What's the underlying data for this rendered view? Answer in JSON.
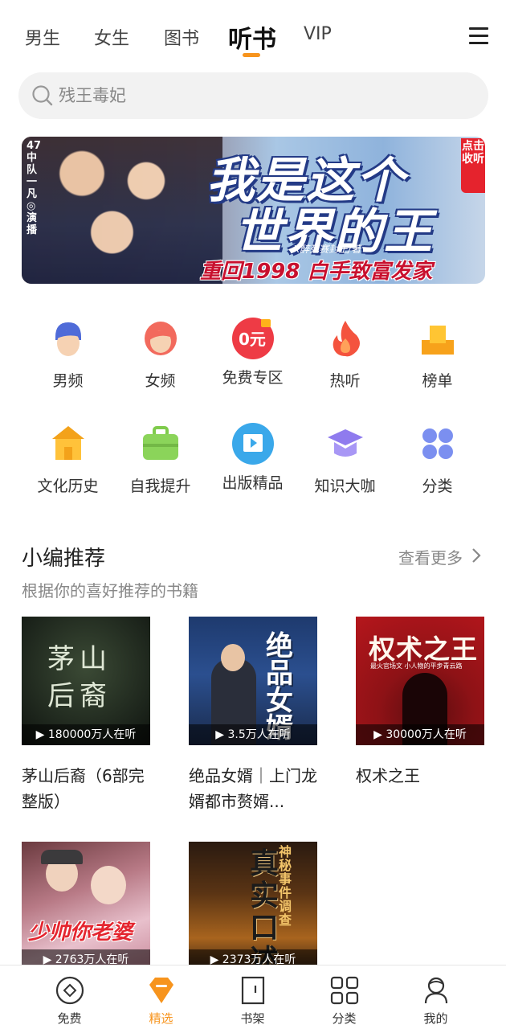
{
  "top_tabs": [
    {
      "label": "男生"
    },
    {
      "label": "女生"
    },
    {
      "label": "图书"
    },
    {
      "label": "听书",
      "active": true
    },
    {
      "label": "VIP"
    }
  ],
  "search": {
    "placeholder": "残王毒妃"
  },
  "banner": {
    "side_text": "47中队一凡◎演播",
    "title_line1": "我是这个",
    "title_line2": "世界的王",
    "author": "X醉死赛封王/著",
    "subtitle": "重回1998 白手致富发家",
    "tag": "点击收听"
  },
  "categories": [
    {
      "label": "男频",
      "icon": "male-avatar-icon"
    },
    {
      "label": "女频",
      "icon": "female-avatar-icon"
    },
    {
      "label": "免费专区",
      "icon": "free-zone-icon",
      "icon_text": "0元"
    },
    {
      "label": "热听",
      "icon": "flame-icon"
    },
    {
      "label": "榜单",
      "icon": "podium-icon"
    },
    {
      "label": "文化历史",
      "icon": "pavilion-icon"
    },
    {
      "label": "自我提升",
      "icon": "briefcase-icon"
    },
    {
      "label": "出版精品",
      "icon": "book-play-icon"
    },
    {
      "label": "知识大咖",
      "icon": "graduation-cap-icon"
    },
    {
      "label": "分类",
      "icon": "grid-four-icon"
    }
  ],
  "section": {
    "title": "小编推荐",
    "more": "查看更多",
    "subtitle": "根据你的喜好推荐的书籍"
  },
  "books": [
    {
      "title": "茅山后裔（6部完整版）",
      "listeners": "180000万人在听",
      "cover_text": "茅山后裔"
    },
    {
      "title": "绝品女婿｜上门龙婿都市赘婿...",
      "listeners": "3.5万人在听",
      "cover_text": "绝品女婿"
    },
    {
      "title": "权术之王",
      "listeners": "30000万人在听",
      "cover_text": "权术之王",
      "cover_sub": "最火官场文 小人物的平步青云路"
    },
    {
      "title": "",
      "listeners": "2763万人在听",
      "cover_text": "少帅你老婆"
    },
    {
      "title": "",
      "listeners": "2373万人在听",
      "cover_text": "真实口述",
      "cover_sub": "神秘事件调查"
    }
  ],
  "bottom_nav": [
    {
      "label": "免费",
      "icon": "free-icon"
    },
    {
      "label": "精选",
      "icon": "featured-icon",
      "active": true
    },
    {
      "label": "书架",
      "icon": "bookshelf-icon"
    },
    {
      "label": "分类",
      "icon": "category-icon"
    },
    {
      "label": "我的",
      "icon": "profile-icon"
    }
  ],
  "colors": {
    "accent": "#f7941d",
    "text": "#222222",
    "muted": "#888888"
  }
}
